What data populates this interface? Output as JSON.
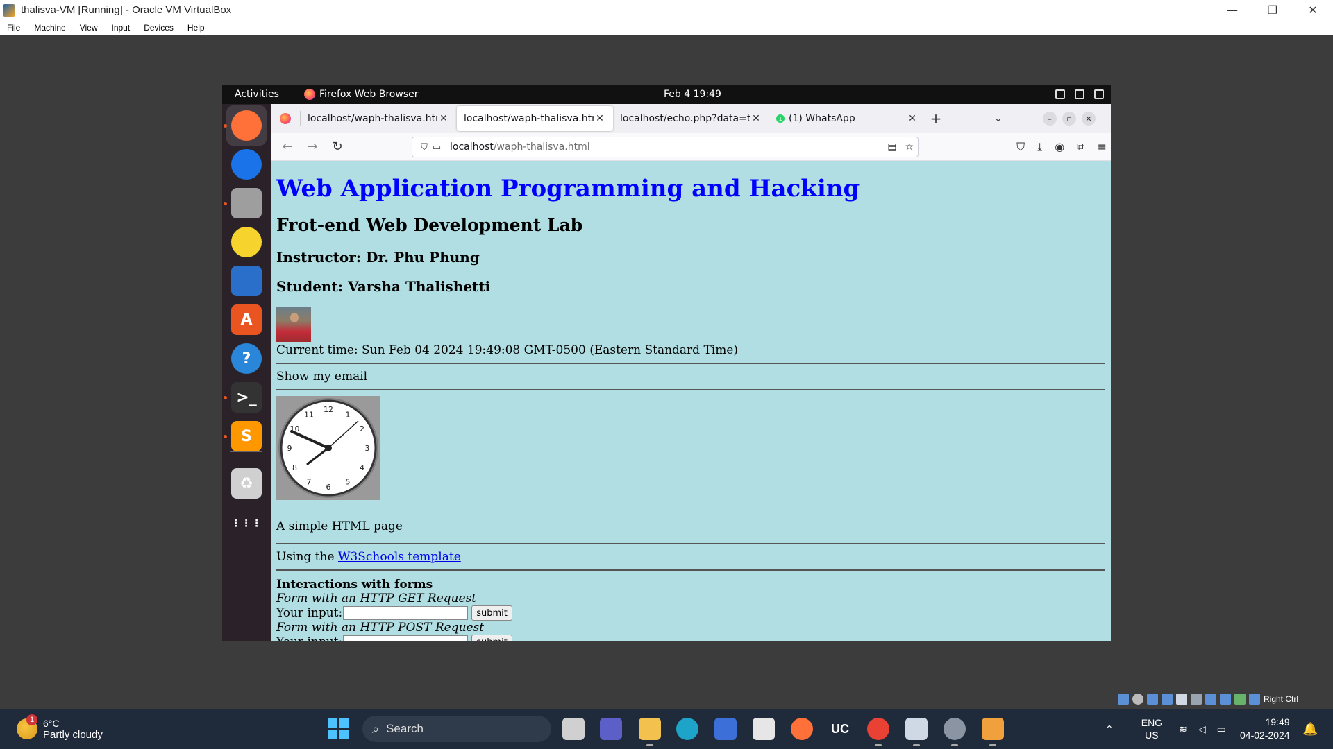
{
  "host_window": {
    "title": "thalisva-VM [Running] - Oracle VM VirtualBox",
    "menu": [
      "File",
      "Machine",
      "View",
      "Input",
      "Devices",
      "Help"
    ]
  },
  "gnome": {
    "activities": "Activities",
    "focused_app": "Firefox Web Browser",
    "clock": "Feb 4  19:49"
  },
  "dock": [
    {
      "name": "firefox",
      "color": "#ff7139",
      "glyph": "",
      "running": true
    },
    {
      "name": "thunderbird",
      "color": "#1a73e8",
      "glyph": "",
      "running": false
    },
    {
      "name": "files",
      "color": "#9e9e9e",
      "glyph": "",
      "running": true
    },
    {
      "name": "rhythmbox",
      "color": "#f6d32d",
      "glyph": "",
      "running": false
    },
    {
      "name": "libreoffice-writer",
      "color": "#2a6fc9",
      "glyph": "",
      "running": false
    },
    {
      "name": "app-center",
      "color": "#e95420",
      "glyph": "A",
      "running": false
    },
    {
      "name": "help",
      "color": "#2a86d8",
      "glyph": "?",
      "running": false
    },
    {
      "name": "terminal",
      "color": "#333333",
      "glyph": ">_",
      "running": true
    },
    {
      "name": "sublime-text",
      "color": "#ff9800",
      "glyph": "S",
      "running": true
    },
    {
      "name": "trash",
      "color": "#d0d0d0",
      "glyph": "♻",
      "running": false
    },
    {
      "name": "show-apps",
      "color": "#2a2228",
      "glyph": "⋮⋮⋮",
      "running": false
    }
  ],
  "browser": {
    "tabs": [
      {
        "title": "localhost/waph-thalisva.htm",
        "selected": false
      },
      {
        "title": "localhost/waph-thalisva.htm",
        "selected": true
      },
      {
        "title": "localhost/echo.php?data=te",
        "selected": false
      },
      {
        "title": "(1) WhatsApp",
        "selected": false,
        "badge": "1"
      }
    ],
    "url_host": "localhost",
    "url_path": "/waph-thalisva.html"
  },
  "page": {
    "h1": "Web Application Programming and Hacking",
    "h2": "Frot-end Web Development Lab",
    "instructor": "Instructor: Dr. Phu Phung",
    "student": "Student: Varsha Thalishetti",
    "current_time": "Current time: Sun Feb 04 2024 19:49:08 GMT-0500 (Eastern Standard Time)",
    "show_email": "Show my email",
    "clock_numbers": [
      "12",
      "1",
      "2",
      "3",
      "4",
      "5",
      "6",
      "7",
      "8",
      "9",
      "10",
      "11"
    ],
    "simple_page": "A simple HTML page",
    "using_prefix": "Using the ",
    "template_link": "W3Schools template",
    "forms_title": "Interactions with forms",
    "get_form_label": "Form with an HTTP GET Request",
    "input_label": "Your input:",
    "submit_label": "submit",
    "post_form_label": "Form with an HTTP POST Request"
  },
  "taskbar": {
    "weather_temp": "6°C",
    "weather_cond": "Partly cloudy",
    "weather_badge": "1",
    "search_label": "Search",
    "lang_1": "ENG",
    "lang_2": "US",
    "time": "19:49",
    "date": "04-02-2024",
    "host_key": "Right Ctrl"
  }
}
